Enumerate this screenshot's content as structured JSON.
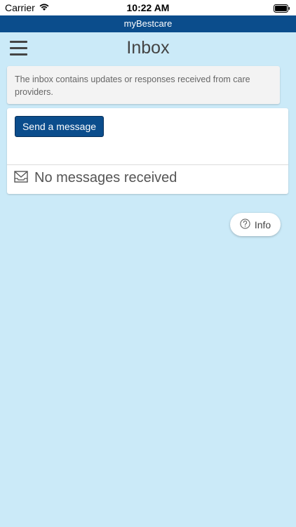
{
  "status_bar": {
    "carrier": "Carrier",
    "time": "10:22 AM"
  },
  "app_bar": {
    "title": "myBestcare"
  },
  "header": {
    "title": "Inbox"
  },
  "info_note": {
    "text": "The inbox contains updates or responses received from care providers."
  },
  "messages": {
    "send_label": "Send a message",
    "empty_text": "No messages received"
  },
  "info_button": {
    "label": "Info"
  },
  "icons": {
    "menu": "hamburger-menu-icon",
    "envelope": "envelope-icon",
    "help": "question-circle-icon",
    "wifi": "wifi-icon",
    "battery": "battery-icon"
  },
  "colors": {
    "primary": "#0b4d8c",
    "background": "#cbeaf8"
  }
}
